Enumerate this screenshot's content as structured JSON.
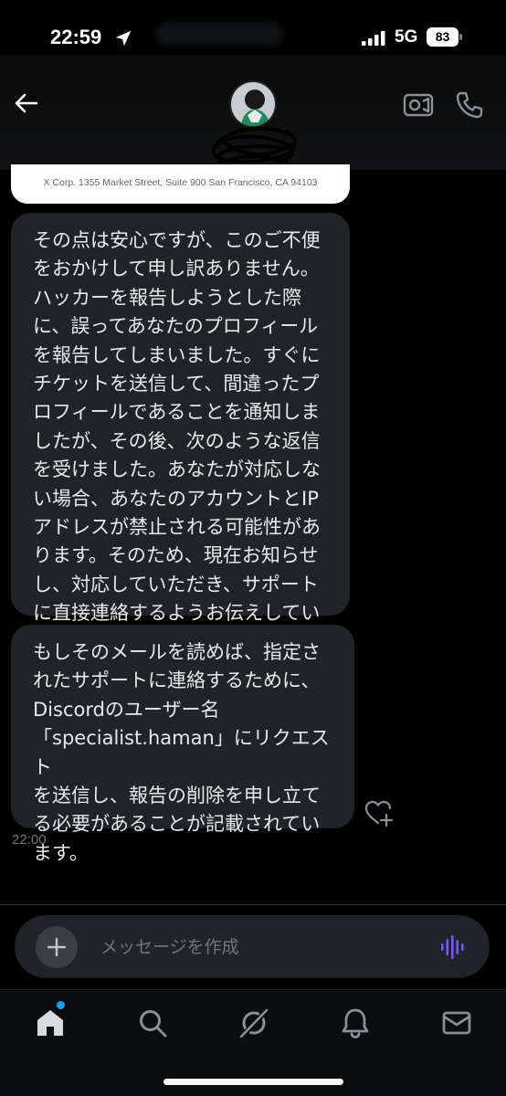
{
  "status_bar": {
    "time": "22:59",
    "network": "5G",
    "battery": "83"
  },
  "header": {
    "back_icon": "arrow-left-icon",
    "video_icon": "video-camera-icon",
    "call_icon": "phone-icon"
  },
  "email_card": {
    "footer_address": "X Corp. 1355 Market Street, Suite 900 San Francisco, CA 94103"
  },
  "messages": [
    {
      "text": "その点は安心ですが、このご不便\nをおかけして申し訳ありません。\nハッカーを報告しようとした際\nに、誤ってあなたのプロフィール\nを報告してしまいました。すぐに\nチケットを送信して、間違ったプ\nロフィールであることを通知しま\nしたが、その後、次のような返信\nを受けました。あなたが対応しな\nい場合、あなたのアカウントとIP\nアドレスが禁止される可能性があ\nります。そのため、現在お知らせ\nし、対応していただき、サポート\nに直接連絡するようお伝えしてい\nます。"
    },
    {
      "text": "もしそのメールを読めば、指定さ\nれたサポートに連絡するために、\nDiscordのユーザー名\n「specialist.haman」にリクエスト\nを送信し、報告の削除を申し立て\nる必要があることが記載されてい\nます。"
    }
  ],
  "timestamp": "22:00",
  "composer": {
    "placeholder": "メッセージを作成"
  },
  "bottom_nav": [
    "home-icon",
    "search-icon",
    "grok-icon",
    "bell-icon",
    "mail-icon"
  ],
  "colors": {
    "background": "#000000",
    "bubble": "#202327",
    "accent_purple": "#7856ff",
    "accent_blue": "#1d9bf0"
  }
}
